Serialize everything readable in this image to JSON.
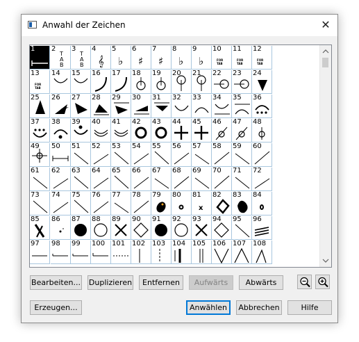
{
  "dialog": {
    "title": "Anwahl der Zeichen",
    "close_glyph": "✕"
  },
  "grid": {
    "selected": "1",
    "cells": [
      "1",
      "2",
      "3",
      "4",
      "5",
      "6",
      "7",
      "8",
      "9",
      "10",
      "11",
      "12",
      "13",
      "14",
      "15",
      "16",
      "17",
      "18",
      "19",
      "20",
      "21",
      "22",
      "23",
      "24",
      "25",
      "26",
      "27",
      "28",
      "29",
      "30",
      "31",
      "32",
      "33",
      "34",
      "35",
      "36",
      "37",
      "38",
      "39",
      "40",
      "41",
      "42",
      "43",
      "44",
      "45",
      "46",
      "47",
      "48",
      "49",
      "50",
      "51",
      "52",
      "53",
      "54",
      "55",
      "56",
      "57",
      "58",
      "59",
      "60",
      "61",
      "62",
      "63",
      "64",
      "65",
      "66",
      "67",
      "68",
      "69",
      "70",
      "71",
      "72",
      "73",
      "74",
      "75",
      "76",
      "77",
      "78",
      "79",
      "80",
      "81",
      "82",
      "83",
      "84",
      "85",
      "86",
      "87",
      "88",
      "89",
      "90",
      "91",
      "92",
      "93",
      "94",
      "95",
      "96",
      "97",
      "98",
      "99",
      "100",
      "101",
      "102",
      "103",
      "104",
      "105",
      "106",
      "107",
      "108"
    ],
    "symbols": {
      "line": "line",
      "tab1": "T A B",
      "small_text": "FOR TAB",
      "icons": {
        "scroll_up": "chevron-up-icon",
        "scroll_down": "chevron-down-icon"
      }
    }
  },
  "buttons": {
    "edit": "Bearbeiten...",
    "duplicate": "Duplizieren",
    "remove": "Entfernen",
    "up": "Aufwärts",
    "down": "Abwärts",
    "create": "Erzeugen...",
    "select": "Anwählen",
    "cancel": "Abbrechen",
    "help": "Hilfe"
  },
  "icons": {
    "zoom_out": "zoom-out-icon",
    "zoom_in": "zoom-in-icon",
    "app": "window-icon"
  }
}
